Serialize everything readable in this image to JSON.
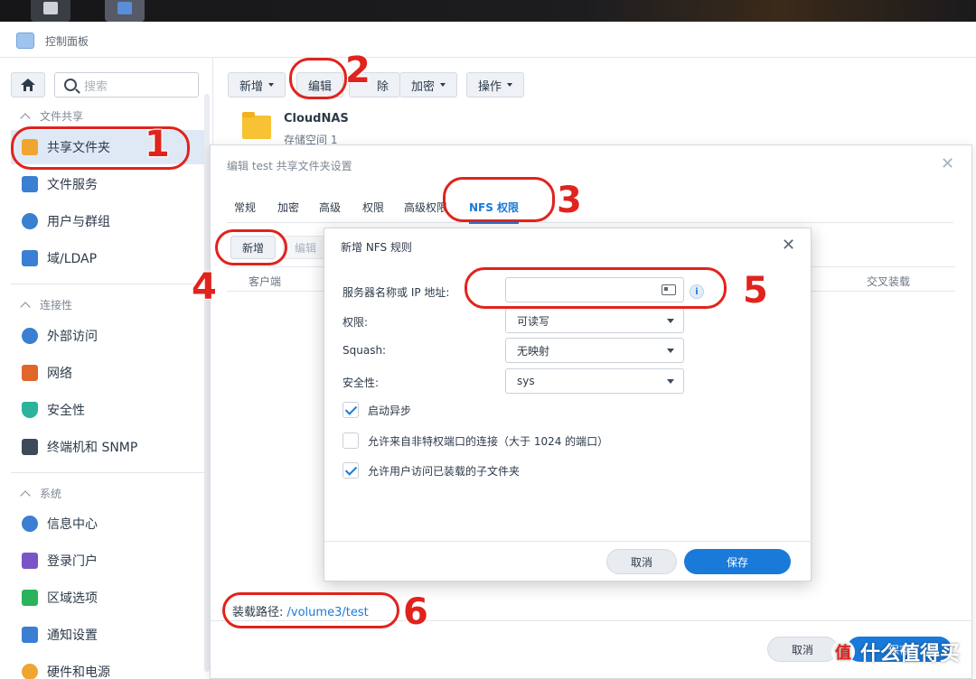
{
  "app": {
    "title": "控制面板"
  },
  "search": {
    "placeholder": "搜索"
  },
  "sidebar": {
    "sections": [
      {
        "label": "文件共享"
      },
      {
        "label": "连接性"
      },
      {
        "label": "系统"
      }
    ],
    "items": [
      {
        "label": "共享文件夹",
        "icon": "shared-folder-icon",
        "color": "#f0a531"
      },
      {
        "label": "文件服务",
        "icon": "file-services-icon",
        "color": "#3a7fd1"
      },
      {
        "label": "用户与群组",
        "icon": "users-icon",
        "color": "#3a7fd1"
      },
      {
        "label": "域/LDAP",
        "icon": "domain-icon",
        "color": "#3a7fd1"
      },
      {
        "label": "外部访问",
        "icon": "external-access-icon",
        "color": "#3a7fd1"
      },
      {
        "label": "网络",
        "icon": "network-icon",
        "color": "#e0662a"
      },
      {
        "label": "安全性",
        "icon": "security-shield-icon",
        "color": "#2bb39b"
      },
      {
        "label": "终端机和 SNMP",
        "icon": "terminal-icon",
        "color": "#3c4a5a"
      },
      {
        "label": "信息中心",
        "icon": "info-center-icon",
        "color": "#3a7fd1"
      },
      {
        "label": "登录门户",
        "icon": "login-portal-icon",
        "color": "#7a55c7"
      },
      {
        "label": "区域选项",
        "icon": "regional-options-icon",
        "color": "#2bb35c"
      },
      {
        "label": "通知设置",
        "icon": "notification-icon",
        "color": "#3a7fd1"
      },
      {
        "label": "硬件和电源",
        "icon": "hardware-power-icon",
        "color": "#f0a531"
      }
    ]
  },
  "toolbar": {
    "create": "新增",
    "edit": "编辑",
    "delete_partial": "除",
    "encrypt": "加密",
    "action": "操作"
  },
  "shared_folder": {
    "name": "CloudNAS",
    "location": "存储空间 1",
    "bottom_partial": "存储空间 1"
  },
  "settings_dialog": {
    "title": "编辑 test 共享文件夹设置",
    "tabs": [
      "常规",
      "加密",
      "高级",
      "权限",
      "高级权限",
      "NFS 权限"
    ],
    "buttons": {
      "create": "新增",
      "edit": "编辑"
    },
    "columns": {
      "client": "客户端",
      "cross_mount": "交叉装载"
    },
    "mount_label": "装载路径:",
    "mount_path": "/volume3/test",
    "cancel": "取消",
    "save": "保存"
  },
  "nfs_dialog": {
    "title": "新增 NFS 规则",
    "fields": {
      "host_label": "服务器名称或 IP 地址:",
      "host_value": "",
      "privilege_label": "权限:",
      "privilege_value": "可读写",
      "squash_label": "Squash:",
      "squash_value": "无映射",
      "security_label": "安全性:",
      "security_value": "sys"
    },
    "checkboxes": [
      {
        "label": "启动异步",
        "checked": true
      },
      {
        "label": "允许来自非特权端口的连接（大于 1024 的端口）",
        "checked": false
      },
      {
        "label": "允许用户访问已装载的子文件夹",
        "checked": true
      }
    ],
    "cancel": "取消",
    "save": "保存"
  },
  "annotations": [
    "1",
    "2",
    "3",
    "4",
    "5",
    "6"
  ],
  "watermark": {
    "text": "什么值得买",
    "logo": "值"
  },
  "colors": {
    "accent": "#1a7ad9",
    "annotation": "#e0231c"
  }
}
